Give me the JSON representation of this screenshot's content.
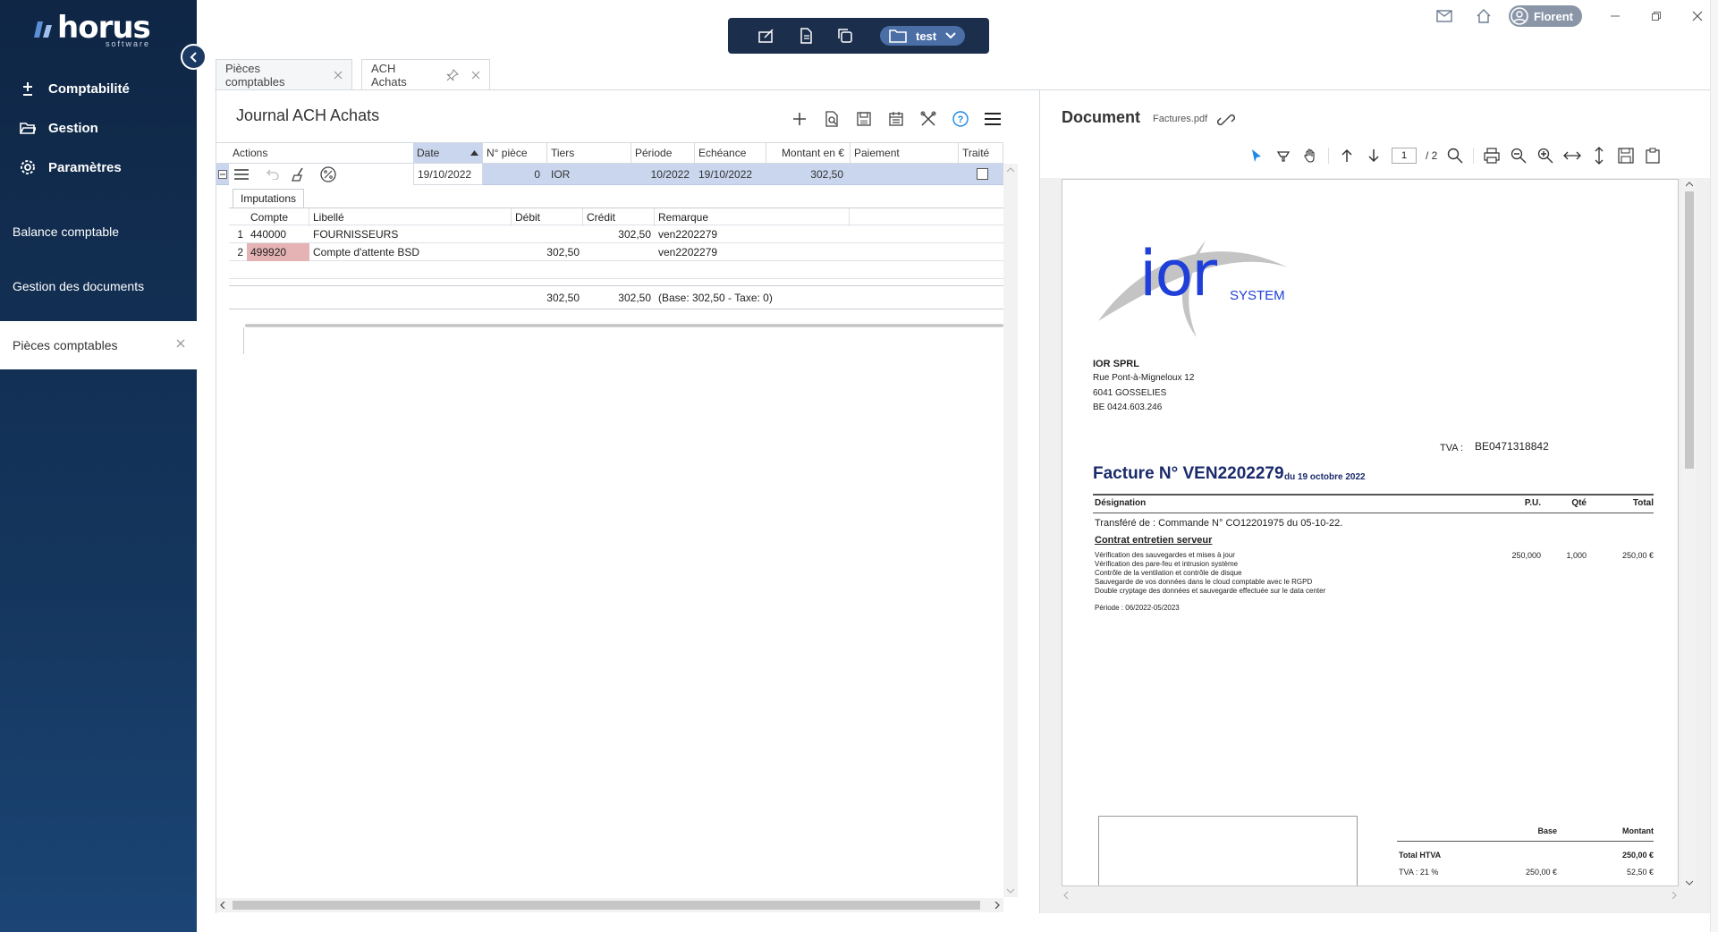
{
  "brand": {
    "name": "horus",
    "sub": "software"
  },
  "sidebar": {
    "main": [
      {
        "label": "Comptabilité",
        "icon": "plus-minus-icon"
      },
      {
        "label": "Gestion",
        "icon": "folder-open-icon"
      },
      {
        "label": "Paramètres",
        "icon": "gear-icon"
      }
    ],
    "sub": [
      "Balance comptable",
      "Gestion des documents"
    ],
    "active": "Pièces comptables"
  },
  "topbar": {
    "folder": "test",
    "user": "Florent"
  },
  "tabs": [
    "Pièces comptables",
    "ACH Achats"
  ],
  "journal": {
    "title": "Journal ACH Achats",
    "columns": [
      "Actions",
      "Date",
      "N° pièce",
      "Tiers",
      "Période",
      "Echéance",
      "Montant en €",
      "Paiement",
      "Traité"
    ],
    "row": {
      "date": "19/10/2022",
      "piece": "0",
      "tiers": "IOR",
      "periode": "10/2022",
      "echeance": "19/10/2022",
      "montant": "302,50",
      "paiement": "",
      "traite": false
    },
    "imputations_tab": "Imputations",
    "imp_columns": [
      "Compte",
      "Libellé",
      "Débit",
      "Crédit",
      "Remarque"
    ],
    "imputations": [
      {
        "n": "1",
        "compte": "440000",
        "libelle": "FOURNISSEURS",
        "debit": "",
        "credit": "302,50",
        "remarque": "ven2202279"
      },
      {
        "n": "2",
        "compte": "499920",
        "libelle": "Compte d'attente BSD",
        "debit": "302,50",
        "credit": "",
        "remarque": "ven2202279"
      }
    ],
    "totals": {
      "debit": "302,50",
      "credit": "302,50",
      "note": "(Base: 302,50 - Taxe: 0)"
    }
  },
  "document": {
    "title": "Document",
    "file": "Factures.pdf",
    "page": "1",
    "pages": "/ 2",
    "invoice": {
      "logo_main": "ior",
      "logo_sub": "SYSTEM",
      "company": "IOR SPRL",
      "address1": "Rue Pont-à-Migneloux 12",
      "address2": "6041  GOSSELIES",
      "vat_no": "BE 0424.603.246",
      "tva_label": "TVA :",
      "client_tva": "BE0471318842",
      "title": "Facture N° VEN2202279",
      "date": "du 19 octobre 2022",
      "col_designation": "Désignation",
      "col_pu": "P.U.",
      "col_qte": "Qté",
      "col_total": "Total",
      "transfer": "Transféré de : Commande N° CO12201975 du 05-10-22.",
      "item_title": "Contrat entretien serveur",
      "item_lines": [
        "Vérification des sauvegardes et mises à jour",
        "Vérification des pare-feu et intrusion système",
        "Contrôle de la ventilation et contrôle de disque",
        "Sauvegarde de vos données dans le cloud comptable avec le RGPD",
        "Double cryptage des données et sauvegarde effectuée sur le data center"
      ],
      "item_pu": "250,000",
      "item_qte": "1,000",
      "item_total": "250,00 €",
      "periode": "Période : 06/2022-05/2023",
      "sum_base_label": "Base",
      "sum_montant_label": "Montant",
      "htva_label": "Total HTVA",
      "htva": "250,00 €",
      "tva_rate_label": "TVA :   21 %",
      "tva_base": "250,00 €",
      "tva_amount": "52,50 €"
    }
  },
  "colors": {
    "sidebar": "#14355c",
    "selected_row": "#c9d6ee",
    "accent": "#1e88e5"
  }
}
